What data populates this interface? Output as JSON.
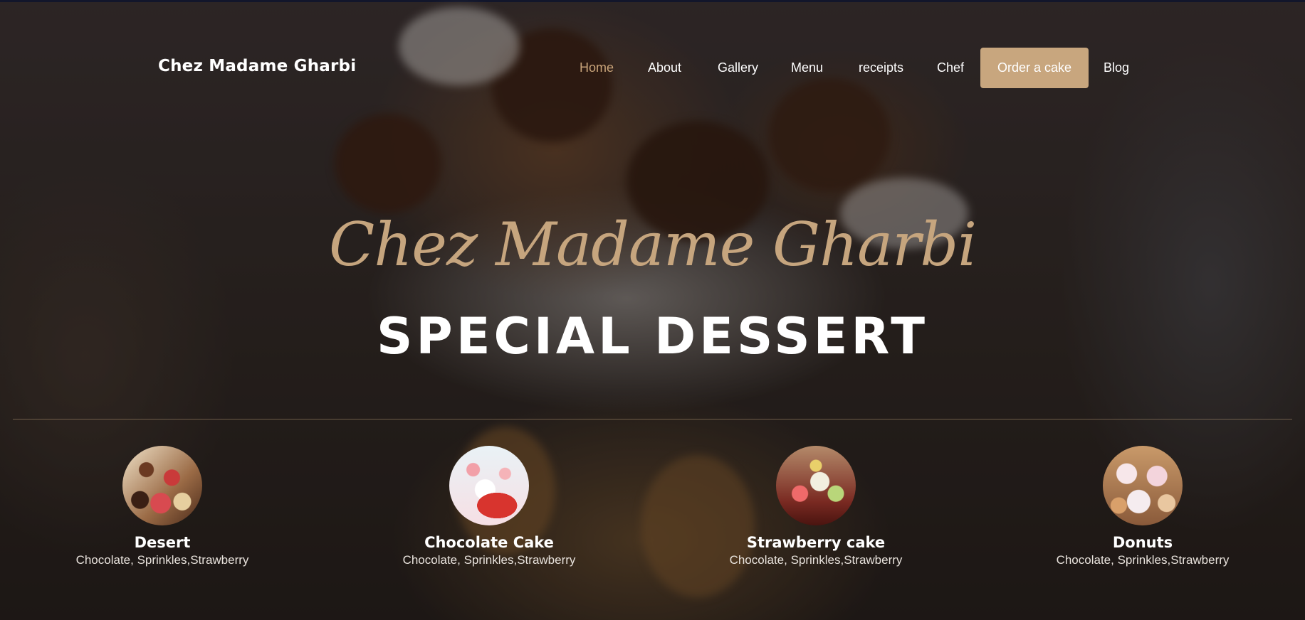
{
  "brand": "Chez Madame Gharbi",
  "nav": [
    {
      "label": "Home",
      "active": true
    },
    {
      "label": "About"
    },
    {
      "label": "Gallery"
    },
    {
      "label": "Menu"
    },
    {
      "label": "receipts"
    },
    {
      "label": "Chef"
    },
    {
      "label": "Order a cake",
      "cta": true
    },
    {
      "label": "Blog"
    }
  ],
  "hero": {
    "script_title": "Chez Madame Gharbi",
    "main_title": "SPECIAL DESSERT"
  },
  "categories": [
    {
      "name": "Desert",
      "desc": "Chocolate, Sprinkles,Strawberry"
    },
    {
      "name": "Chocolate Cake",
      "desc": "Chocolate, Sprinkles,Strawberry"
    },
    {
      "name": "Strawberry cake",
      "desc": "Chocolate, Sprinkles,Strawberry"
    },
    {
      "name": "Donuts",
      "desc": "Chocolate, Sprinkles,Strawberry"
    }
  ],
  "colors": {
    "accent": "#c8a67e",
    "active_nav": "#c9a47a",
    "text": "#ffffff"
  }
}
